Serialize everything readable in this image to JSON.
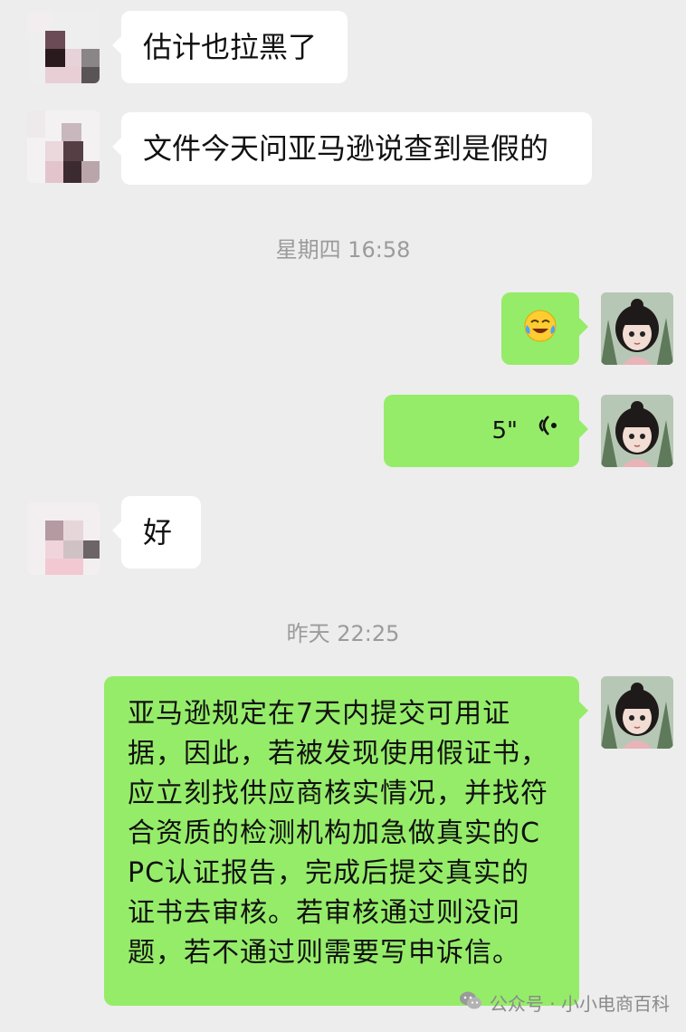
{
  "messages": [
    {
      "side": "left",
      "type": "text",
      "text": "估计也拉黑了"
    },
    {
      "side": "left",
      "type": "text",
      "text": "文件今天问亚马逊说查到是假的"
    },
    {
      "type": "timestamp",
      "text": "星期四 16:58"
    },
    {
      "side": "right",
      "type": "emoji",
      "text": "😭"
    },
    {
      "side": "right",
      "type": "voice",
      "duration": "5\""
    },
    {
      "side": "left",
      "type": "text",
      "text": "好"
    },
    {
      "type": "timestamp",
      "text": "昨天 22:25"
    },
    {
      "side": "right",
      "type": "text",
      "text": "亚马逊规定在7天内提交可用证据，因此，若被发现使用假证书，应立刻找供应商核实情况，并找符合资质的检测机构加急做真实的CPC认证报告，完成后提交真实的证书去审核。若审核通过则没问题，若不通过则需要写申诉信。"
    }
  ],
  "watermark": {
    "icon": "wechat-icon",
    "text": "公众号 · 小小电商百科"
  },
  "colors": {
    "background": "#ededed",
    "left_bubble": "#ffffff",
    "right_bubble": "#95ec69"
  }
}
